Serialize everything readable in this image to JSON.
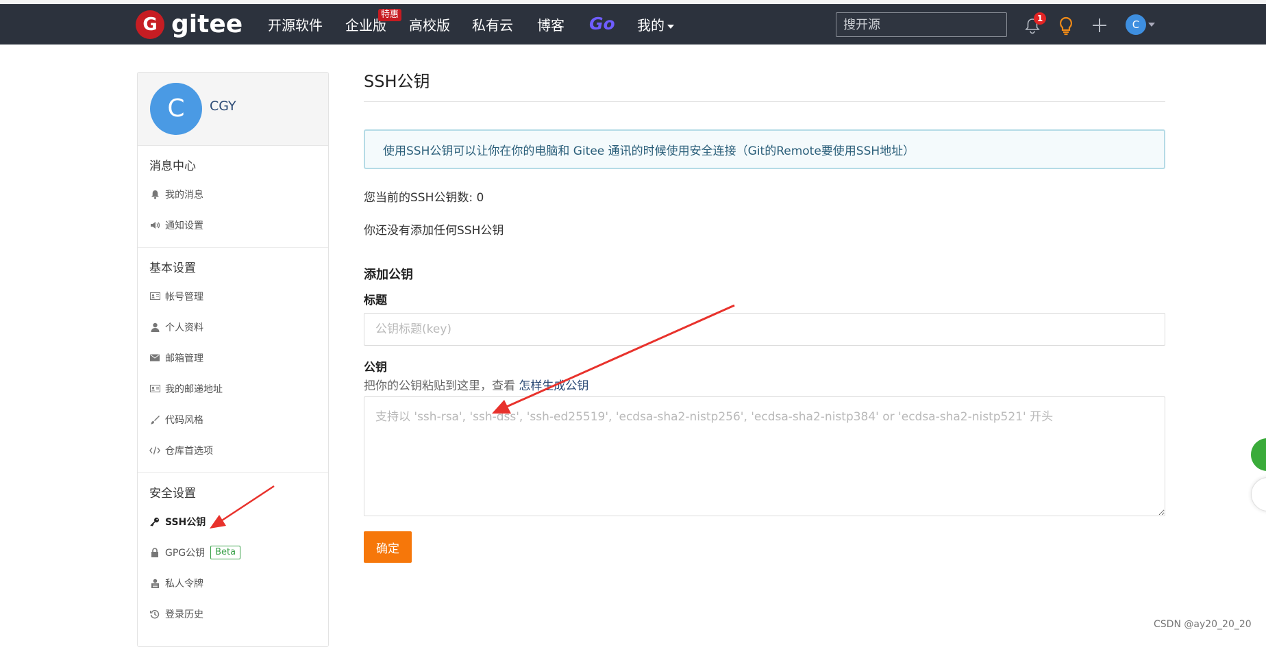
{
  "navbar": {
    "logo_text": "gitee",
    "items": [
      "开源软件",
      "企业版",
      "高校版",
      "私有云",
      "博客"
    ],
    "go_label": "Go",
    "mine_label": "我的",
    "hot_badge": "特惠",
    "search_placeholder": "搜开源",
    "notification_count": "1",
    "avatar_letter": "C"
  },
  "sidebar": {
    "avatar_letter": "C",
    "username": "CGY",
    "groups": [
      {
        "title": "消息中心",
        "items": [
          "我的消息",
          "通知设置"
        ]
      },
      {
        "title": "基本设置",
        "items": [
          "帐号管理",
          "个人资料",
          "邮箱管理",
          "我的邮递地址",
          "代码风格",
          "仓库首选项"
        ]
      },
      {
        "title": "安全设置",
        "items": [
          "SSH公钥",
          "GPG公钥",
          "私人令牌",
          "登录历史"
        ]
      }
    ],
    "beta_label": "Beta"
  },
  "main": {
    "title": "SSH公钥",
    "info": "使用SSH公钥可以让你在你的电脑和 Gitee 通讯的时候使用安全连接（Git的Remote要使用SSH地址）",
    "count_text": "您当前的SSH公钥数: 0",
    "empty_text": "你还没有添加任何SSH公钥",
    "add_title": "添加公钥",
    "title_label": "标题",
    "title_placeholder": "公钥标题(key)",
    "key_label": "公钥",
    "key_hint_prefix": "把你的公钥粘贴到这里，查看 ",
    "key_hint_link": "怎样生成公钥",
    "key_placeholder": "支持以 'ssh-rsa', 'ssh-dss', 'ssh-ed25519', 'ecdsa-sha2-nistp256', 'ecdsa-sha2-nistp384' or 'ecdsa-sha2-nistp521' 开头",
    "submit_label": "确定"
  },
  "watermark": "CSDN @ay20_20_20",
  "colors": {
    "navbar_bg": "#2c323d",
    "brand_red": "#c71d23",
    "accent_orange": "#f6770a",
    "go_purple": "#6f5dff",
    "beta_green": "#3aa149",
    "arrow_red": "#e8322c"
  }
}
